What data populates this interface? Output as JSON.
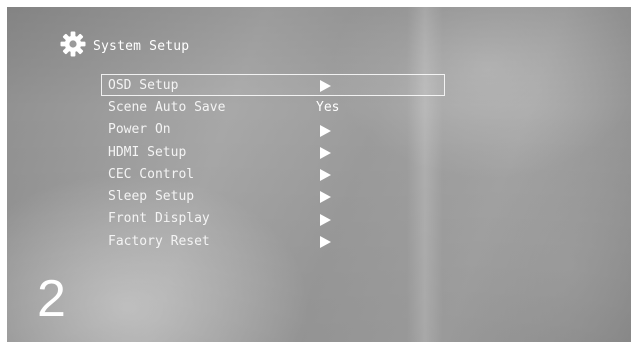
{
  "header": {
    "title": "System Setup",
    "icon": "gear-icon"
  },
  "menu": {
    "items": [
      {
        "label": "OSD Setup",
        "value": "",
        "indicator": "arrow-right-icon",
        "selected": true
      },
      {
        "label": "Scene Auto Save",
        "value": "Yes",
        "indicator": "",
        "selected": false
      },
      {
        "label": "Power On",
        "value": "",
        "indicator": "arrow-right-icon",
        "selected": false
      },
      {
        "label": "HDMI Setup",
        "value": "",
        "indicator": "arrow-right-icon",
        "selected": false
      },
      {
        "label": "CEC Control",
        "value": "",
        "indicator": "arrow-right-icon",
        "selected": false
      },
      {
        "label": "Sleep Setup",
        "value": "",
        "indicator": "arrow-right-icon",
        "selected": false
      },
      {
        "label": "Front Display",
        "value": "",
        "indicator": "arrow-right-icon",
        "selected": false
      },
      {
        "label": "Factory Reset",
        "value": "",
        "indicator": "arrow-right-icon",
        "selected": false
      }
    ]
  },
  "step_number": "2"
}
